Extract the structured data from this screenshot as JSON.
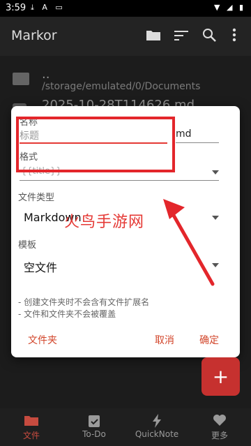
{
  "status": {
    "time": "3:59",
    "left_icons": "⤓ A ▭",
    "right_icons": "▼ ◢ ▮"
  },
  "toolbar": {
    "title": "Markor",
    "icons": [
      "folder-icon",
      "sort-icon",
      "search-icon",
      "more-vert-icon"
    ]
  },
  "list": {
    "items": [
      {
        "name": "..",
        "path": "/storage/emulated/0/Documents"
      },
      {
        "name": "2025-10-28T114626.md",
        "path": ""
      }
    ]
  },
  "dialog": {
    "name_label": "名称",
    "name_placeholder": "标题",
    "name_suffix": "md",
    "format_label": "格式",
    "format_value": "{{title}}",
    "filetype_label": "文件类型",
    "filetype_value": "Markdown",
    "template_label": "模板",
    "template_value": "空文件",
    "hint1": "- 创建文件夹时不会含有文件扩展名",
    "hint2": "- 文件和文件夹不会被覆盖",
    "btn_folder": "文件夹",
    "btn_cancel": "取消",
    "btn_ok": "确定"
  },
  "annotation": {
    "watermark": "火鸟手游网"
  },
  "fab": {
    "label": "+"
  },
  "bottom_nav": {
    "tabs": [
      {
        "label": "文件",
        "active": true
      },
      {
        "label": "To-Do",
        "active": false
      },
      {
        "label": "QuickNote",
        "active": false
      },
      {
        "label": "更多",
        "active": false
      }
    ]
  },
  "colors": {
    "accent": "#c64b3f",
    "annotation_red": "#e3262b"
  }
}
